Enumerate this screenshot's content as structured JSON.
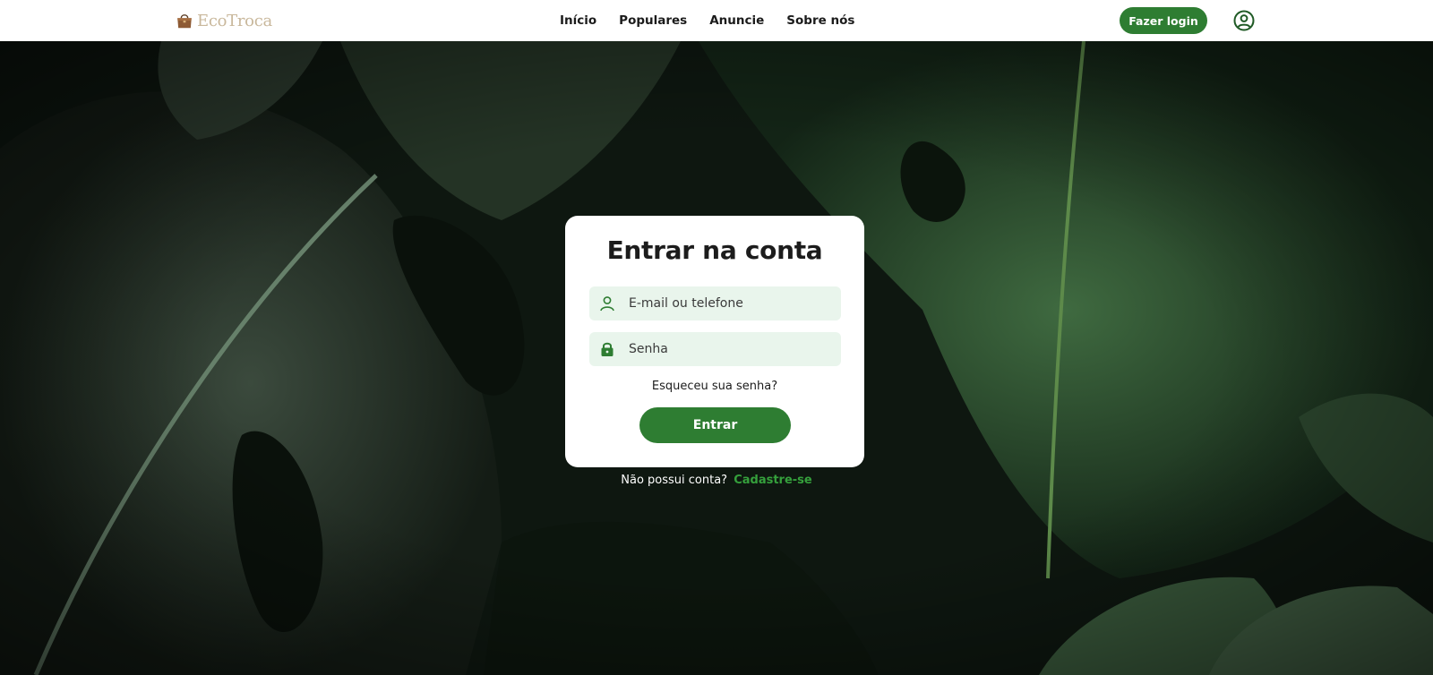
{
  "header": {
    "brand": "EcoTroca",
    "nav": [
      {
        "label": "Início"
      },
      {
        "label": "Populares"
      },
      {
        "label": "Anuncie"
      },
      {
        "label": "Sobre nós"
      }
    ],
    "login_label": "Fazer login"
  },
  "login": {
    "title": "Entrar na conta",
    "email_placeholder": "E-mail ou telefone",
    "password_placeholder": "Senha",
    "forgot_label": "Esqueceu sua senha?",
    "submit_label": "Entrar",
    "no_account_text": "Não possui conta?",
    "signup_label": "Cadastre-se"
  },
  "icons": {
    "logo": "handbag-icon",
    "account": "user-circle-icon",
    "email_field": "user-icon",
    "password_field": "lock-icon"
  },
  "colors": {
    "primary": "#2e7d32",
    "input_bg": "#e9f5ec",
    "signup_link": "#35a03c",
    "brand_text": "#c9b89c"
  }
}
